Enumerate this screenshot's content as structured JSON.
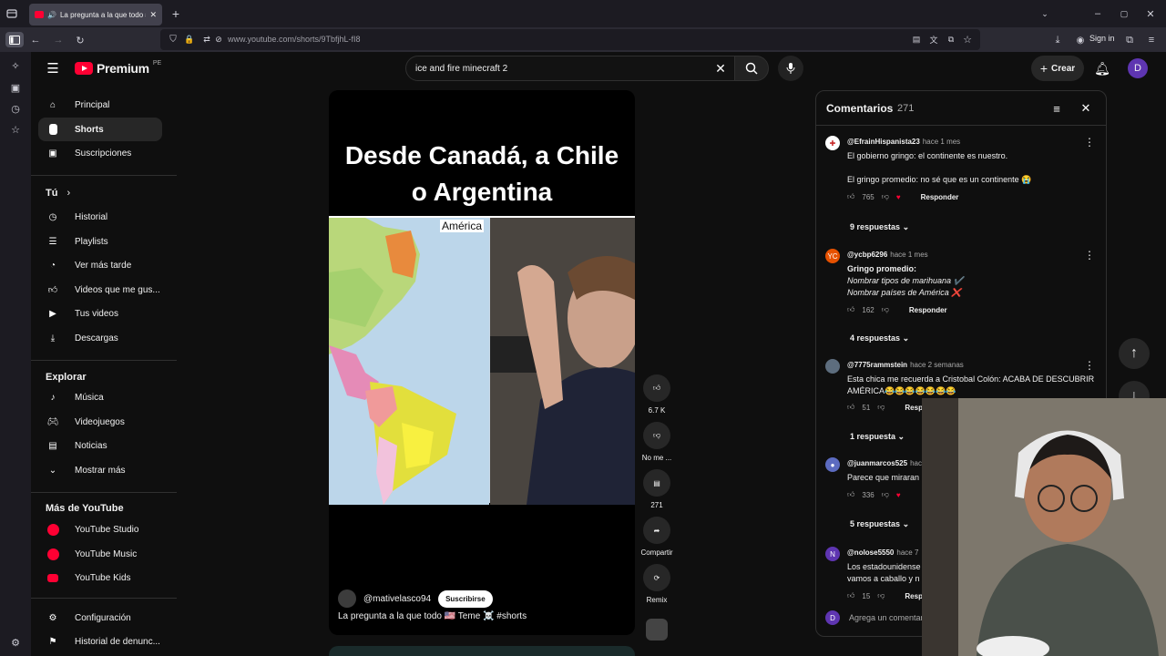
{
  "browser": {
    "tab_title": "La pregunta a la que todo #",
    "url": "www.youtube.com/shorts/9TbfjhL-fI8",
    "sign_in": "Sign in"
  },
  "header": {
    "logo_text": "Premium",
    "logo_region": "PE",
    "search_value": "ice and fire minecraft 2",
    "create_label": "Crear",
    "avatar_letter": "D"
  },
  "sidebar": {
    "main": [
      {
        "label": "Principal",
        "icon": "home-icon"
      },
      {
        "label": "Shorts",
        "icon": "shorts-icon"
      },
      {
        "label": "Suscripciones",
        "icon": "subscriptions-icon"
      }
    ],
    "you_label": "Tú",
    "you": [
      {
        "label": "Historial",
        "icon": "history-icon"
      },
      {
        "label": "Playlists",
        "icon": "playlists-icon"
      },
      {
        "label": "Ver más tarde",
        "icon": "watch-later-icon"
      },
      {
        "label": "Videos que me gus...",
        "icon": "liked-videos-icon"
      },
      {
        "label": "Tus videos",
        "icon": "your-videos-icon"
      },
      {
        "label": "Descargas",
        "icon": "downloads-icon"
      }
    ],
    "explore_label": "Explorar",
    "explore": [
      {
        "label": "Música",
        "icon": "music-icon"
      },
      {
        "label": "Videojuegos",
        "icon": "gaming-icon"
      },
      {
        "label": "Noticias",
        "icon": "news-icon"
      },
      {
        "label": "Mostrar más",
        "icon": "chevron-down-icon"
      }
    ],
    "more_label": "Más de YouTube",
    "more": [
      {
        "label": "YouTube Studio"
      },
      {
        "label": "YouTube Music"
      },
      {
        "label": "YouTube Kids"
      }
    ],
    "settings": [
      {
        "label": "Configuración",
        "icon": "settings-icon"
      },
      {
        "label": "Historial de denunc...",
        "icon": "flag-icon"
      }
    ]
  },
  "short": {
    "caption_line1": "Desde Canadá, a Chile",
    "caption_line2": "o Argentina",
    "map_label": "América",
    "channel": "@mativelasco94",
    "subscribe": "Suscribirse",
    "title": "La pregunta a la que todo 🇺🇸 Teme ☠️ #shorts",
    "actions": {
      "likes": "6.7 K",
      "dislike": "No me ...",
      "comments": "271",
      "share": "Compartir",
      "remix": "Remix"
    }
  },
  "comments": {
    "title": "Comentarios",
    "count": "271",
    "add_placeholder": "Agrega un comentar",
    "items": [
      {
        "user": "@EfrainHispanista23",
        "time": "hace 1 mes",
        "lines": [
          "El gobierno gringo: el continente es nuestro.",
          "",
          "El gringo promedio: no sé que es un continente 😭"
        ],
        "likes": "765",
        "reply": "Responder",
        "replies": "9 respuestas",
        "avatar_color": "#c62828"
      },
      {
        "user": "@ycbp6296",
        "time": "hace 1 mes",
        "lines": [
          "Gringo promedio:",
          "Nombrar tipos de marihuana ✔️",
          "Nombrar países de América ❌"
        ],
        "likes": "162",
        "reply": "Responder",
        "replies": "4 respuestas",
        "avatar_color": "#e65100",
        "avatar_text": "YC"
      },
      {
        "user": "@7775rammstein",
        "time": "hace 2 semanas",
        "lines": [
          "Esta chica me recuerda a Cristobal Colón: ACABA DE DESCUBRIR",
          "AMÉRICA😂😂😂😂😂😂😂"
        ],
        "likes": "51",
        "reply": "Resp",
        "replies": "1 respuesta",
        "avatar_color": "#5d6d7e"
      },
      {
        "user": "@juanmarcos525",
        "time": "hac",
        "lines": [
          "Parece que miraran"
        ],
        "likes": "336",
        "reply": "",
        "replies": "5 respuestas",
        "avatar_color": "#5c6bc0"
      },
      {
        "user": "@nolose5550",
        "time": "hace 7",
        "lines": [
          "Los estadounidense",
          "vamos a caballo y n"
        ],
        "likes": "15",
        "reply": "Resp",
        "replies": "",
        "avatar_color": "#5e35b1",
        "avatar_text": "N"
      }
    ]
  }
}
